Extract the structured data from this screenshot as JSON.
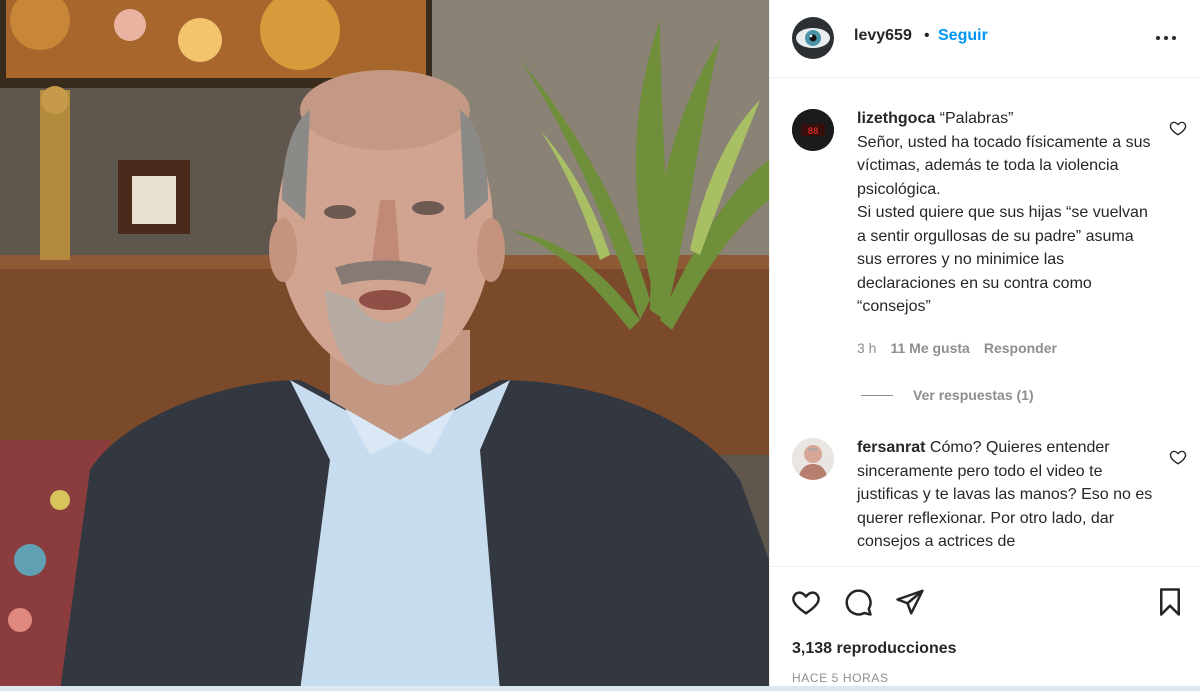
{
  "post": {
    "username": "levy659",
    "separator": "•",
    "follow_label": "Seguir"
  },
  "comments": [
    {
      "username": "lizethgoca",
      "text": " “Palabras”\nSeñor, usted ha tocado físicamente a sus víctimas, además te toda la violencia psicológica.\nSi usted quiere que sus hijas “se vuelvan a sentir orgullosas de su padre” asuma sus errores y no minimice las declaraciones en su contra como “consejos”",
      "age": "3 h",
      "likes": "11 Me gusta",
      "reply_label": "Responder",
      "view_replies": "Ver respuestas (1)",
      "avatar_text": "88"
    },
    {
      "username": "fersanrat",
      "text": " Cómo? Quieres entender sinceramente pero todo el video te justificas y te lavas las manos? Eso no es querer reflexionar. Por otro lado, dar consejos a actrices de"
    }
  ],
  "footer": {
    "views": "3,138 reproducciones",
    "posted": "HACE 5 HORAS"
  },
  "icons": {
    "like": "heart-icon",
    "comment": "comment-icon",
    "share": "share-icon",
    "save": "bookmark-icon",
    "more": "more-options-icon"
  },
  "colors": {
    "accent": "#0095f6",
    "text": "#262626",
    "muted": "#8e8e8e",
    "border": "#efefef"
  }
}
